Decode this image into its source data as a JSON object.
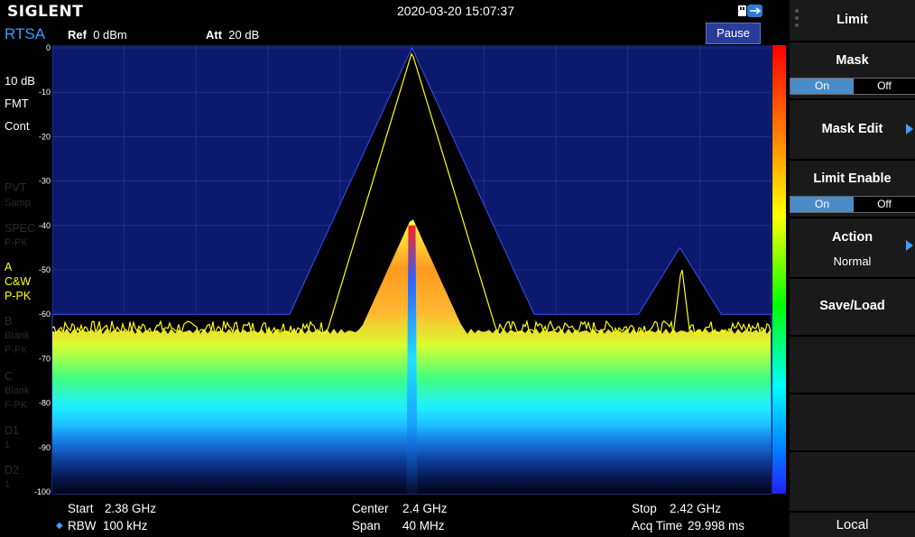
{
  "header": {
    "brand": "SIGLENT",
    "datetime": "2020-03-20 15:07:37"
  },
  "infobar": {
    "mode": "RTSA",
    "ref_label": "Ref",
    "ref_value": "0 dBm",
    "att_label": "Att",
    "att_value": "20 dB",
    "pause_label": "Pause"
  },
  "left": {
    "scale": "10 dB",
    "fmt": "FMT",
    "cont": "Cont",
    "pvt": "PVT",
    "pvt_sub": "Samp",
    "spec": "SPEC",
    "spec_sub": "P-PK",
    "trace_a": "A",
    "trace_a_mode": "C&W",
    "trace_a_det": "P-PK",
    "trace_b": "B",
    "trace_b_mode": "Blank",
    "trace_b_det": "P-PK",
    "trace_c": "C",
    "trace_c_mode": "Blank",
    "trace_c_det": "F-PK",
    "d1": "D1",
    "d1_sub": "1",
    "d2": "D2",
    "d2_sub": "1"
  },
  "yticks": [
    "0",
    "-10",
    "-20",
    "-30",
    "-40",
    "-50",
    "-60",
    "-70",
    "-80",
    "-90",
    "-100"
  ],
  "bottom": {
    "start_label": "Start",
    "start_value": "2.38 GHz",
    "rbw_label": "RBW",
    "rbw_value": "100 kHz",
    "center_label": "Center",
    "center_value": "2.4 GHz",
    "span_label": "Span",
    "span_value": "40 MHz",
    "stop_label": "Stop",
    "stop_value": "2.42 GHz",
    "acq_label": "Acq Time",
    "acq_value": "29.998 ms"
  },
  "softkeys": {
    "limit": "Limit",
    "mask": "Mask",
    "mask_on": "On",
    "mask_off": "Off",
    "mask_edit": "Mask Edit",
    "limit_enable": "Limit Enable",
    "limit_on": "On",
    "limit_off": "Off",
    "action": "Action",
    "action_value": "Normal",
    "save_load": "Save/Load",
    "local": "Local"
  },
  "colors": {
    "accent": "#3aa0ff",
    "plot_bg": "#0c1a6e",
    "trace": "#ffff00",
    "toggle_on": "#4a8cc8"
  },
  "chart_data": {
    "type": "line",
    "ylim": [
      -100,
      0
    ],
    "xlim_ghz": [
      2.38,
      2.42
    ],
    "y_unit": "dBm",
    "mask": [
      {
        "x": 2.38,
        "y": -60
      },
      {
        "x": 2.3932,
        "y": -60
      },
      {
        "x": 2.4,
        "y": 0
      },
      {
        "x": 2.4068,
        "y": -60
      },
      {
        "x": 2.4126,
        "y": -60
      },
      {
        "x": 2.4149,
        "y": -45
      },
      {
        "x": 2.4172,
        "y": -60
      },
      {
        "x": 2.42,
        "y": -60
      }
    ],
    "trace": {
      "name": "A",
      "noise_floor": -63,
      "peaks": [
        {
          "x": 2.4,
          "y": -1
        },
        {
          "x": 2.415,
          "y": -49
        }
      ]
    }
  }
}
